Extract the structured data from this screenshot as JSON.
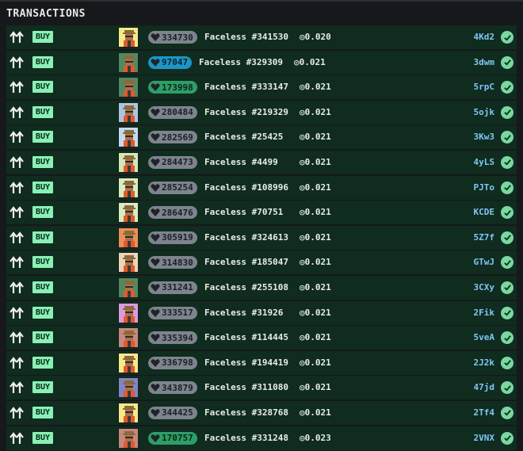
{
  "header": {
    "title": "TRANSACTIONS"
  },
  "colors": {
    "row_bg": "#0f2c1f",
    "buy_bg": "#8af0b6",
    "badge_gray": "#7d848d",
    "badge_blue": "#1b97c7",
    "badge_green": "#2e9e67",
    "txid": "#7fc7f5",
    "check": "#7ad7a0"
  },
  "rows": [
    {
      "type": "BUY",
      "rank": "334730",
      "rank_style": "gray",
      "name": "Faceless #341530",
      "price": "0.020",
      "txid": "4Kd2",
      "avatar_bg": "#f4ea8a"
    },
    {
      "type": "BUY",
      "rank": "97047",
      "rank_style": "blue",
      "name": "Faceless #329309",
      "price": "0.021",
      "txid": "3dwm",
      "avatar_bg": "#4f8a63"
    },
    {
      "type": "BUY",
      "rank": "173998",
      "rank_style": "green",
      "name": "Faceless #333147",
      "price": "0.021",
      "txid": "5rpC",
      "avatar_bg": "#4f8a63"
    },
    {
      "type": "BUY",
      "rank": "280484",
      "rank_style": "gray",
      "name": "Faceless #219329",
      "price": "0.021",
      "txid": "5ojk",
      "avatar_bg": "#a9c7e2"
    },
    {
      "type": "BUY",
      "rank": "282569",
      "rank_style": "gray",
      "name": "Faceless #25425",
      "price": "0.021",
      "txid": "3Kw3",
      "avatar_bg": "#c3d9ee"
    },
    {
      "type": "BUY",
      "rank": "284473",
      "rank_style": "gray",
      "name": "Faceless #4499",
      "price": "0.021",
      "txid": "4yLS",
      "avatar_bg": "#cfe9b8"
    },
    {
      "type": "BUY",
      "rank": "285254",
      "rank_style": "gray",
      "name": "Faceless #108996",
      "price": "0.021",
      "txid": "PJTo",
      "avatar_bg": "#d6edc0"
    },
    {
      "type": "BUY",
      "rank": "286476",
      "rank_style": "gray",
      "name": "Faceless #70751",
      "price": "0.021",
      "txid": "KCDE",
      "avatar_bg": "#d6edc0"
    },
    {
      "type": "BUY",
      "rank": "305919",
      "rank_style": "gray",
      "name": "Faceless #324613",
      "price": "0.021",
      "txid": "5Z7f",
      "avatar_bg": "#e8905a"
    },
    {
      "type": "BUY",
      "rank": "314830",
      "rank_style": "gray",
      "name": "Faceless #185047",
      "price": "0.021",
      "txid": "GTwJ",
      "avatar_bg": "#e9d6b8"
    },
    {
      "type": "BUY",
      "rank": "331241",
      "rank_style": "gray",
      "name": "Faceless #255108",
      "price": "0.021",
      "txid": "3CXy",
      "avatar_bg": "#4f8a63"
    },
    {
      "type": "BUY",
      "rank": "333517",
      "rank_style": "gray",
      "name": "Faceless #31926",
      "price": "0.021",
      "txid": "2Fik",
      "avatar_bg": "#d99be0"
    },
    {
      "type": "BUY",
      "rank": "335394",
      "rank_style": "gray",
      "name": "Faceless #114445",
      "price": "0.021",
      "txid": "5veA",
      "avatar_bg": "#c4897e"
    },
    {
      "type": "BUY",
      "rank": "336798",
      "rank_style": "gray",
      "name": "Faceless #194419",
      "price": "0.021",
      "txid": "2J2k",
      "avatar_bg": "#f4ea8a"
    },
    {
      "type": "BUY",
      "rank": "343879",
      "rank_style": "gray",
      "name": "Faceless #311080",
      "price": "0.021",
      "txid": "47jd",
      "avatar_bg": "#7f86c8"
    },
    {
      "type": "BUY",
      "rank": "344425",
      "rank_style": "gray",
      "name": "Faceless #328768",
      "price": "0.021",
      "txid": "2Tf4",
      "avatar_bg": "#f4ea8a"
    },
    {
      "type": "BUY",
      "rank": "170757",
      "rank_style": "green",
      "name": "Faceless #331248",
      "price": "0.023",
      "txid": "2VNX",
      "avatar_bg": "#c4897e"
    }
  ],
  "icons": {
    "direction": "up-arrows-icon",
    "rank": "heart-icon",
    "currency": "sol-icon",
    "status": "check-circle-icon"
  }
}
